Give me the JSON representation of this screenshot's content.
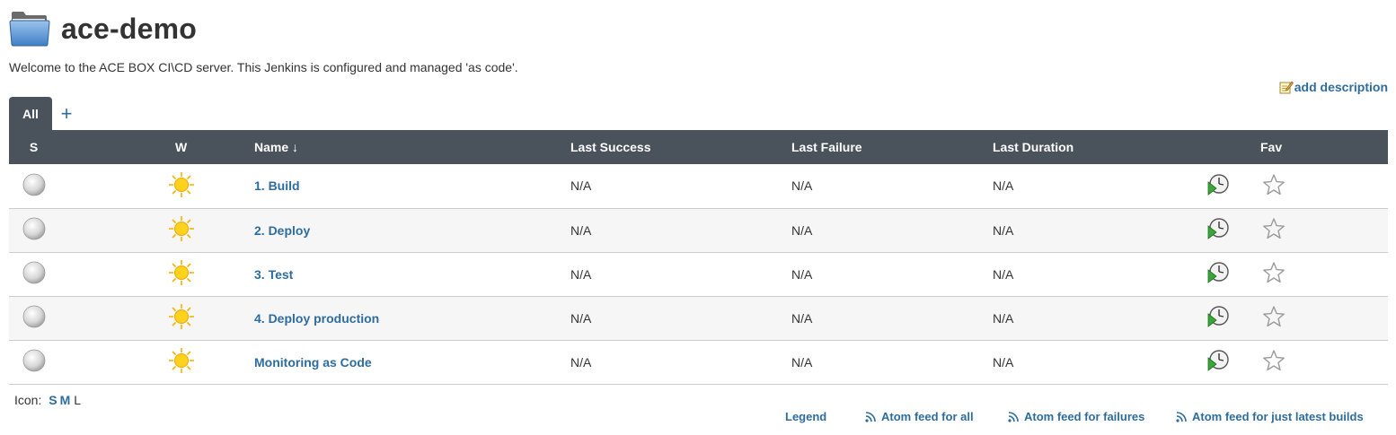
{
  "header": {
    "title": "ace-demo",
    "icon": "folder-icon"
  },
  "description": "Welcome to the ACE BOX CI\\CD server.  This Jenkins is configured and managed 'as code'.",
  "add_description": "add description",
  "tabs": [
    {
      "label": "All",
      "active": true
    }
  ],
  "add_tab_label": "+",
  "table": {
    "columns": [
      "S",
      "W",
      "Name  ↓",
      "Last Success",
      "Last Failure",
      "Last Duration",
      "Fav"
    ],
    "rows": [
      {
        "name": "1. Build",
        "last_success": "N/A",
        "last_failure": "N/A",
        "last_duration": "N/A"
      },
      {
        "name": "2. Deploy",
        "last_success": "N/A",
        "last_failure": "N/A",
        "last_duration": "N/A"
      },
      {
        "name": "3. Test",
        "last_success": "N/A",
        "last_failure": "N/A",
        "last_duration": "N/A"
      },
      {
        "name": "4. Deploy production",
        "last_success": "N/A",
        "last_failure": "N/A",
        "last_duration": "N/A"
      },
      {
        "name": "Monitoring as Code",
        "last_success": "N/A",
        "last_failure": "N/A",
        "last_duration": "N/A"
      }
    ]
  },
  "icon_size": {
    "label": "Icon:",
    "options": [
      "S",
      "M",
      "L"
    ],
    "selected": "L"
  },
  "footer": {
    "legend": "Legend",
    "feed_all": "Atom feed for all",
    "feed_failures": "Atom feed for failures",
    "feed_latest": "Atom feed for just latest builds"
  },
  "colors": {
    "header_bg": "#4a525c",
    "link": "#2e6c9e",
    "row_alt": "#f6f6f6"
  }
}
